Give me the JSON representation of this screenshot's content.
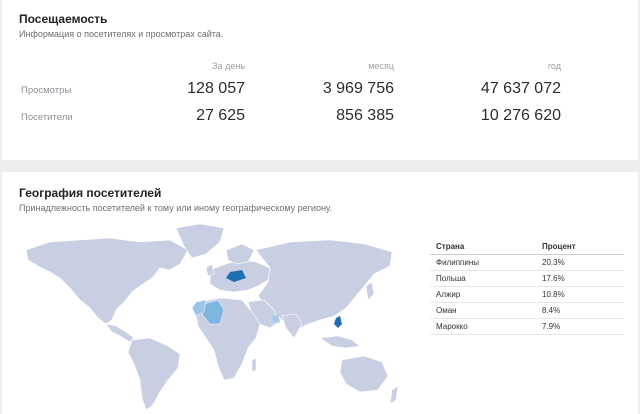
{
  "traffic": {
    "title": "Посещаемость",
    "subtitle": "Информация о посетителях и просмотрах сайта.",
    "columns": [
      "За день",
      "месяц",
      "год"
    ],
    "rows": [
      {
        "label": "Просмотры",
        "day": "128 057",
        "month": "3 969 756",
        "year": "47 637 072"
      },
      {
        "label": "Посетители",
        "day": "27 625",
        "month": "856 385",
        "year": "10 276 620"
      }
    ]
  },
  "geo": {
    "title": "География посетителей",
    "subtitle": "Принадлежность посетителей к тому или иному географическому региону.",
    "table_header": {
      "country": "Страна",
      "percent": "Процент"
    },
    "countries": [
      {
        "name": "Филиппины",
        "percent": "20.3%"
      },
      {
        "name": "Польша",
        "percent": "17.6%"
      },
      {
        "name": "Алжир",
        "percent": "10.8%"
      },
      {
        "name": "Оман",
        "percent": "8.4%"
      },
      {
        "name": "Марокко",
        "percent": "7.9%"
      }
    ],
    "colors": {
      "land": "#c9cfe2",
      "highlight_strong": "#1f6fb2",
      "highlight_light": "#7fb6e0"
    }
  }
}
